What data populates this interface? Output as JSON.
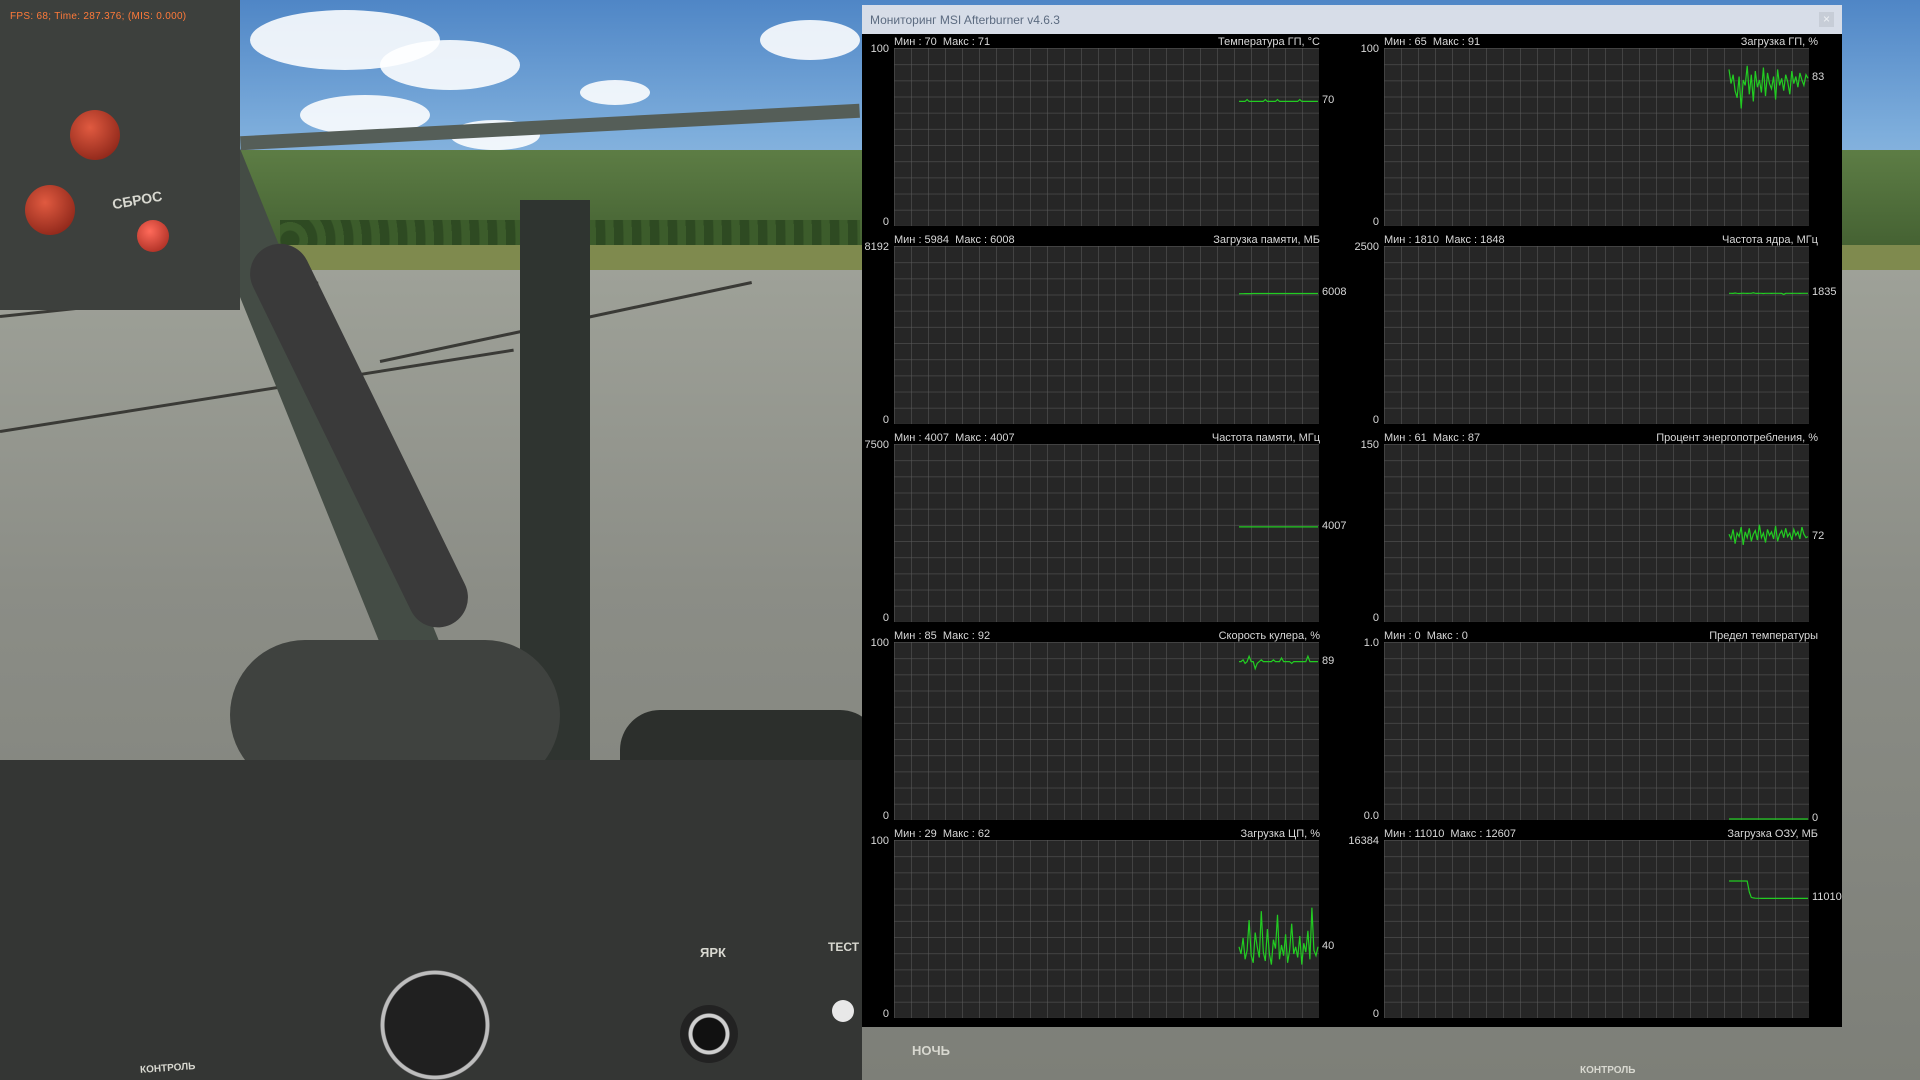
{
  "game_hud": {
    "fps_text": "FPS:   68; Time: 287.376; (MIS: 0.000)"
  },
  "cockpit_labels": {
    "reset": "СБРОС",
    "bright": "ЯРК",
    "test": "ТЕСТ",
    "night": "НОЧЬ",
    "control": "КОНТРОЛЬ",
    "control_2": "КОНТРОЛЬ"
  },
  "window": {
    "title": "Мониторинг MSI Afterburner v4.6.3",
    "close_glyph": "×"
  },
  "accent_colors": {
    "graph_line": "#22cc22",
    "window_bg": "#000000",
    "titlebar_bg": "#d7dde8",
    "hud_text": "#ff7a3a"
  },
  "graphs": [
    {
      "title": "Температура ГП, °C",
      "min_max": "Мин : 70  Макс : 71",
      "y_max": "100",
      "y_min": "0",
      "scale": [
        0,
        100
      ],
      "current": "70",
      "trace": [
        70,
        70,
        70,
        70,
        71,
        70,
        70,
        70,
        70,
        70,
        70,
        70,
        70,
        71,
        70,
        70,
        70,
        70,
        70,
        71,
        70,
        70,
        70,
        70,
        70,
        70,
        70,
        70,
        70,
        70,
        71,
        70,
        70,
        70,
        70,
        70,
        70,
        70,
        70,
        70
      ]
    },
    {
      "title": "Загрузка ГП, %",
      "min_max": "Мин : 65  Макс : 91",
      "y_max": "100",
      "y_min": "0",
      "scale": [
        0,
        100
      ],
      "current": "83",
      "trace": [
        88,
        80,
        85,
        76,
        72,
        84,
        66,
        82,
        79,
        90,
        74,
        85,
        70,
        87,
        78,
        82,
        75,
        89,
        73,
        86,
        80,
        77,
        84,
        71,
        88,
        79,
        83,
        76,
        85,
        81,
        74,
        87,
        80,
        84,
        78,
        86,
        82,
        79,
        85,
        83
      ]
    },
    {
      "title": "Загрузка памяти, МБ",
      "min_max": "Мин : 5984  Макс : 6008",
      "y_max": "8192",
      "y_min": "0",
      "scale": [
        0,
        8192
      ],
      "current": "6008",
      "trace": [
        5990,
        5995,
        5998,
        6000,
        6001,
        6002,
        6003,
        6004,
        6004,
        6005,
        6005,
        6005,
        6006,
        6006,
        6006,
        6006,
        6007,
        6007,
        6007,
        6007,
        6007,
        6007,
        6008,
        6008,
        6008,
        6008,
        6008,
        6008,
        6008,
        6008,
        6008,
        6008,
        6008,
        6008,
        6008,
        6008,
        6008,
        6008,
        6008,
        6008
      ]
    },
    {
      "title": "Частота ядра, МГц",
      "min_max": "Мин : 1810  Макс : 1848",
      "y_max": "2500",
      "y_min": "0",
      "scale": [
        0,
        2500
      ],
      "current": "1835",
      "trace": [
        1835,
        1836,
        1834,
        1840,
        1835,
        1833,
        1835,
        1837,
        1835,
        1834,
        1836,
        1835,
        1842,
        1835,
        1834,
        1836,
        1835,
        1833,
        1835,
        1836,
        1835,
        1834,
        1835,
        1836,
        1835,
        1835,
        1834,
        1820,
        1835,
        1836,
        1835,
        1834,
        1835,
        1836,
        1835,
        1834,
        1835,
        1836,
        1835,
        1835
      ]
    },
    {
      "title": "Частота памяти, МГц",
      "min_max": "Мин : 4007  Макс : 4007",
      "y_max": "7500",
      "y_min": "0",
      "scale": [
        0,
        7500
      ],
      "current": "4007",
      "trace": [
        4007,
        4007,
        4007,
        4007,
        4007,
        4007,
        4007,
        4007,
        4007,
        4007,
        4007,
        4007,
        4007,
        4007,
        4007,
        4007,
        4007,
        4007,
        4007,
        4007,
        4007,
        4007,
        4007,
        4007,
        4007,
        4007,
        4007,
        4007,
        4007,
        4007,
        4007,
        4007,
        4007,
        4007,
        4007,
        4007,
        4007,
        4007,
        4007,
        4007
      ]
    },
    {
      "title": "Процент энергопотребления, %",
      "min_max": "Мин : 61  Макс : 87",
      "y_max": "150",
      "y_min": "0",
      "scale": [
        0,
        150
      ],
      "current": "72",
      "trace": [
        74,
        70,
        78,
        66,
        75,
        72,
        80,
        65,
        76,
        71,
        79,
        68,
        74,
        77,
        69,
        82,
        71,
        75,
        67,
        78,
        73,
        76,
        70,
        81,
        68,
        74,
        77,
        71,
        79,
        72,
        75,
        69,
        78,
        73,
        76,
        70,
        80,
        74,
        71,
        72
      ]
    },
    {
      "title": "Скорость кулера, %",
      "min_max": "Мин : 85  Макс : 92",
      "y_max": "100",
      "y_min": "0",
      "scale": [
        0,
        100
      ],
      "current": "89",
      "trace": [
        89,
        89,
        90,
        88,
        89,
        92,
        89,
        89,
        85,
        88,
        89,
        90,
        89,
        89,
        89,
        89,
        89,
        90,
        89,
        89,
        89,
        91,
        89,
        89,
        89,
        89,
        88,
        89,
        89,
        89,
        89,
        89,
        89,
        89,
        92,
        89,
        89,
        89,
        89,
        89
      ]
    },
    {
      "title": "Предел температуры",
      "min_max": "Мин : 0  Макс : 0",
      "y_max": "1.0",
      "y_min": "0.0",
      "scale": [
        0,
        1
      ],
      "current": "0",
      "trace": [
        0,
        0,
        0,
        0,
        0,
        0,
        0,
        0,
        0,
        0,
        0,
        0,
        0,
        0,
        0,
        0,
        0,
        0,
        0,
        0,
        0,
        0,
        0,
        0,
        0,
        0,
        0,
        0,
        0,
        0,
        0,
        0,
        0,
        0,
        0,
        0,
        0,
        0,
        0,
        0
      ]
    },
    {
      "title": "Загрузка ЦП, %",
      "min_max": "Мин : 29  Макс : 62",
      "y_max": "100",
      "y_min": "0",
      "scale": [
        0,
        100
      ],
      "current": "40",
      "trace": [
        40,
        36,
        45,
        33,
        38,
        55,
        35,
        31,
        48,
        40,
        34,
        60,
        37,
        32,
        50,
        36,
        30,
        44,
        39,
        58,
        33,
        41,
        35,
        47,
        31,
        38,
        53,
        36,
        40,
        34,
        46,
        30,
        42,
        37,
        49,
        33,
        62,
        38,
        35,
        40
      ]
    },
    {
      "title": "Загрузка ОЗУ, МБ",
      "min_max": "Мин : 11010  Макс : 12607",
      "y_max": "16384",
      "y_min": "0",
      "scale": [
        0,
        16384
      ],
      "current": "11010",
      "trace": [
        12607,
        12607,
        12607,
        12607,
        12607,
        12607,
        12607,
        12607,
        12607,
        12600,
        11600,
        11100,
        11050,
        11030,
        11020,
        11015,
        11012,
        11010,
        11010,
        11010,
        11010,
        11010,
        11010,
        11010,
        11010,
        11010,
        11010,
        11010,
        11010,
        11010,
        11010,
        11010,
        11010,
        11010,
        11010,
        11010,
        11010,
        11010,
        11010,
        11010
      ]
    }
  ]
}
